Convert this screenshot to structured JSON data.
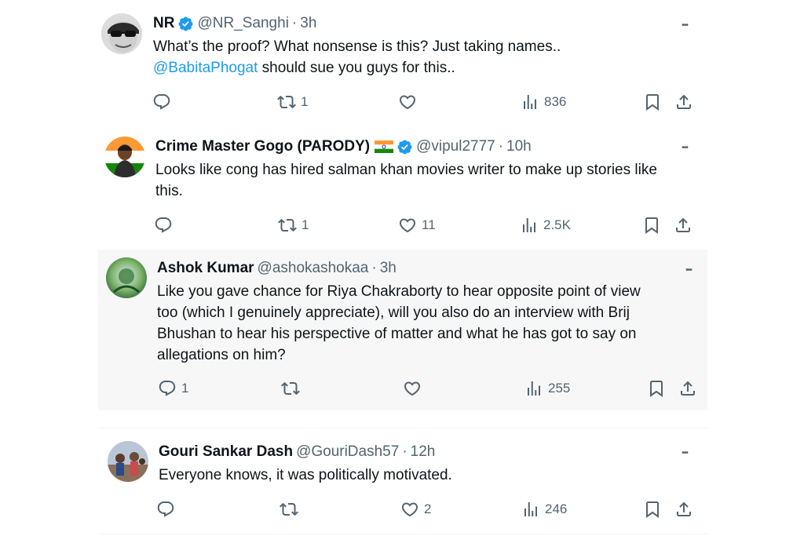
{
  "tweets": [
    {
      "name": "NR",
      "handle": "@NR_Sanghi",
      "time": "3h",
      "text_main": "What’s the proof? What nonsense is this? Just taking names..",
      "mention": "@BabitaPhogat",
      "text_after": " should sue you guys for this..",
      "replies": "",
      "reposts": "1",
      "likes": "",
      "views": "836",
      "verified": true
    },
    {
      "name": "Crime Master Gogo (PARODY)",
      "handle": "@vipul2777",
      "time": "10h",
      "text_line1": "Looks like cong has hired salman khan movies writer to make up stories like",
      "text_line2": "this.",
      "replies": "",
      "reposts": "1",
      "likes": "11",
      "views": "2.5K",
      "verified": true,
      "flag": "india-flag"
    },
    {
      "name": "Ashok Kumar",
      "handle": "@ashokashokaa",
      "time": "3h",
      "text_line1": "Like you gave chance for Riya Chakraborty to hear opposite point of view",
      "text_line2": "too (which I genuinely appreciate), will you also do an interview with Brij",
      "text_line3": "Bhushan to hear his perspective of matter and what he has got to say on",
      "text_line4": "allegations on him?",
      "replies": "1",
      "reposts": "",
      "likes": "",
      "views": "255",
      "verified": false
    },
    {
      "name": "Gouri Sankar Dash",
      "handle": "@GouriDash57",
      "time": "12h",
      "text_line1": "Everyone knows, it was politically motivated.",
      "replies": "",
      "reposts": "",
      "likes": "2",
      "views": "246",
      "verified": false
    }
  ],
  "ui": {
    "dot": "·",
    "more": "•••"
  },
  "colors": {
    "accent": "#1d9bf0",
    "secondary_text": "#536471",
    "highlight_bg": "#f7f7f7"
  }
}
